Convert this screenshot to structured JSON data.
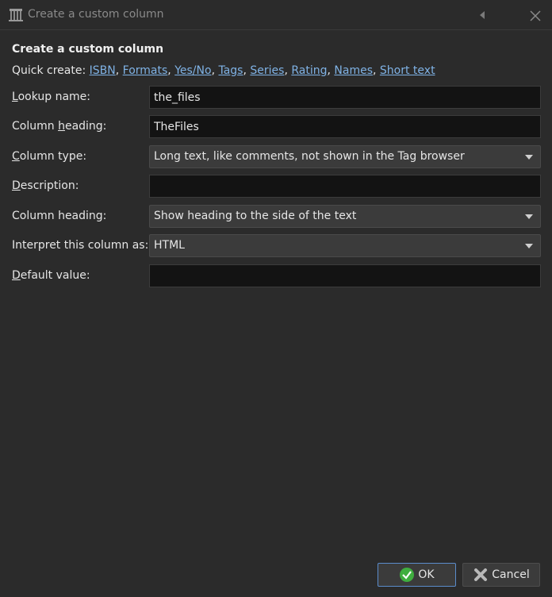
{
  "window": {
    "title": "Create a custom column",
    "app_icon": "calibre-library-icon"
  },
  "dialog": {
    "heading": "Create a custom column",
    "quick_create_label": "Quick create:",
    "quick_create_links": [
      "ISBN",
      "Formats",
      "Yes/No",
      "Tags",
      "Series",
      "Rating",
      "Names",
      "Short text"
    ]
  },
  "form": {
    "lookup_name": {
      "label_pre": "",
      "label_mnemonic": "L",
      "label_post": "ookup name:",
      "value": "the_files"
    },
    "column_heading": {
      "label_pre": "Column ",
      "label_mnemonic": "h",
      "label_post": "eading:",
      "value": "TheFiles"
    },
    "column_type": {
      "label_pre": "",
      "label_mnemonic": "C",
      "label_post": "olumn type:",
      "value": "Long text, like comments, not shown in the Tag browser"
    },
    "description": {
      "label_pre": "",
      "label_mnemonic": "D",
      "label_post": "escription:",
      "value": ""
    },
    "heading_position": {
      "label": "Column heading:",
      "value": "Show heading to the side of the text"
    },
    "interpret_as": {
      "label": "Interpret this column as:",
      "value": "HTML"
    },
    "default_value": {
      "label_pre": "",
      "label_mnemonic": "D",
      "label_post": "efault value:",
      "value": ""
    }
  },
  "buttons": {
    "ok_label": "OK",
    "cancel_label": "Cancel"
  },
  "colors": {
    "background": "#2b2b2b",
    "link": "#7fb2e5",
    "ok_icon": "#3fae3f",
    "cancel_icon": "#b9b9b9"
  }
}
